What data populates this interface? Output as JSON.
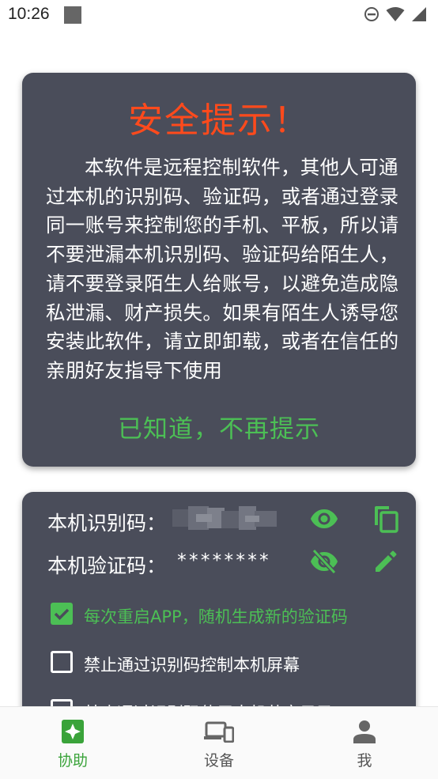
{
  "status_bar": {
    "time": "10:26",
    "icons": [
      "notification-square-icon",
      "dnd-icon",
      "wifi-icon",
      "signal-icon"
    ]
  },
  "warning": {
    "title": "安全提示！",
    "body": "本软件是远程控制软件，其他人可通过本机的识别码、验证码，或者通过登录同一账号来控制您的手机、平板，所以请不要泄漏本机识别码、验证码给陌生人，请不要登录陌生人给账号，以避免造成隐私泄漏、财产损失。如果有陌生人诱导您安装此软件，请立即卸载，或者在信任的亲朋好友指导下使用",
    "ack_label": "已知道，不再提示"
  },
  "device_info": {
    "id_label": "本机识别码：",
    "code_label": "本机验证码：",
    "code_value": "********",
    "options": [
      {
        "label": "每次重启APP，随机生成新的验证码",
        "checked": true
      },
      {
        "label": "禁止通过识别码控制本机屏幕",
        "checked": false
      },
      {
        "label": "禁止通过识别码使用本机共享目录",
        "checked": false
      }
    ]
  },
  "nav": {
    "items": [
      {
        "label": "协助",
        "active": true
      },
      {
        "label": "设备",
        "active": false
      },
      {
        "label": "我",
        "active": false
      }
    ]
  },
  "colors": {
    "card": "#4a4d5a",
    "accent": "#4cbf55",
    "warning": "#ff4a1c",
    "nav_active": "#3aa33a",
    "nav_inactive": "#666666"
  }
}
